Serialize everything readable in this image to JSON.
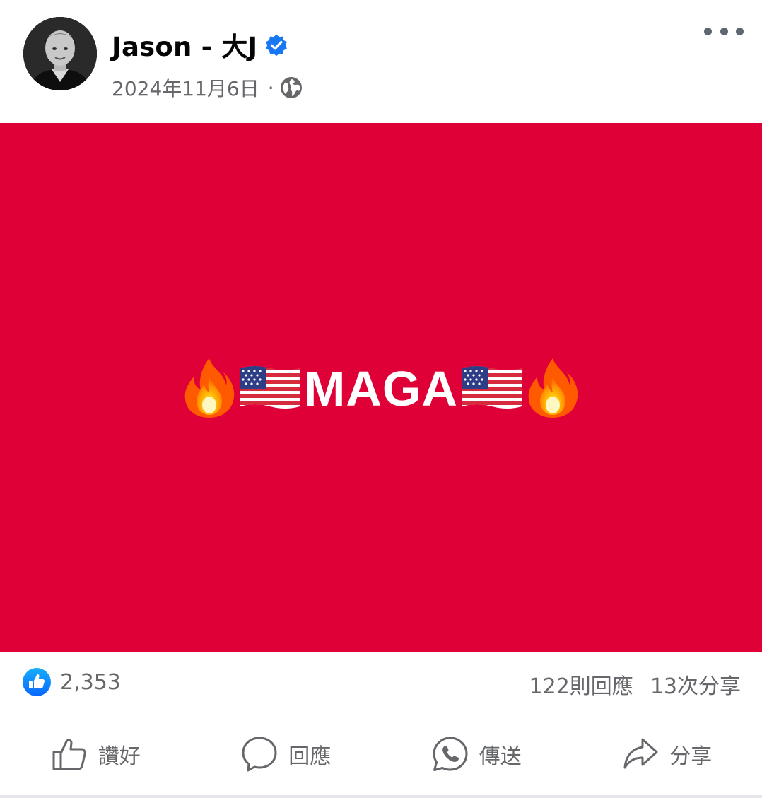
{
  "post": {
    "author": "Jason - 大J",
    "date": "2024年11月6日",
    "separator": "·",
    "verified": true,
    "icons": {
      "verified": "verified-badge-icon",
      "privacy": "globe-icon",
      "menu": "more-options-icon"
    },
    "image": {
      "background_color": "#e00038",
      "text": "MAGA",
      "text_color": "#ffffff",
      "decorations": [
        "fire-emoji",
        "us-flag-emoji",
        "us-flag-emoji",
        "fire-emoji"
      ]
    }
  },
  "stats": {
    "reaction_icon": "like-reaction-icon",
    "likes": "2,353",
    "comments": "122則回應",
    "shares": "13次分享"
  },
  "actions": [
    {
      "label": "讚好",
      "icon": "thumbs-up-icon"
    },
    {
      "label": "回應",
      "icon": "comment-icon"
    },
    {
      "label": "傳送",
      "icon": "whatsapp-icon"
    },
    {
      "label": "分享",
      "icon": "share-arrow-icon"
    }
  ],
  "colors": {
    "accent": "#1877f2",
    "secondary_text": "#65676b",
    "primary_text": "#050505"
  }
}
